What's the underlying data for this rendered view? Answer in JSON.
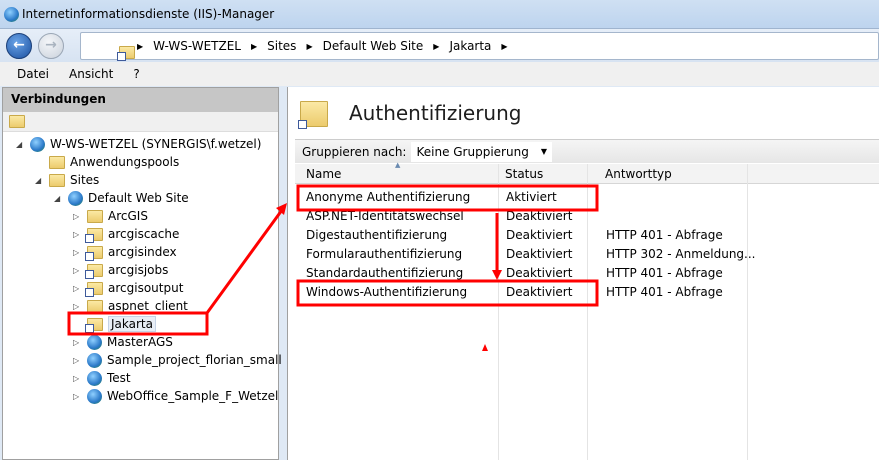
{
  "window": {
    "title": "Internetinformationsdienste (IIS)-Manager"
  },
  "address": {
    "crumbs": [
      "W-WS-WETZEL",
      "Sites",
      "Default Web Site",
      "Jakarta"
    ]
  },
  "menu": [
    "Datei",
    "Ansicht",
    "?"
  ],
  "connections": {
    "title": "Verbindungen",
    "tree": [
      {
        "label": "W-WS-WETZEL (SYNERGIS\\f.wetzel)",
        "icon": "server-icon",
        "level": 0,
        "toggle": "expanded"
      },
      {
        "label": "Anwendungspools",
        "icon": "app-pool-icon",
        "level": 1,
        "toggle": "none"
      },
      {
        "label": "Sites",
        "icon": "sites-folder-icon",
        "level": 1,
        "toggle": "expanded"
      },
      {
        "label": "Default Web Site",
        "icon": "globe-icon",
        "level": 2,
        "toggle": "expanded"
      },
      {
        "label": "ArcGIS",
        "icon": "folder-icon",
        "level": 3,
        "toggle": "collapsed"
      },
      {
        "label": "arcgiscache",
        "icon": "virtual-dir-icon",
        "level": 3,
        "toggle": "collapsed"
      },
      {
        "label": "arcgisindex",
        "icon": "virtual-dir-icon",
        "level": 3,
        "toggle": "collapsed"
      },
      {
        "label": "arcgisjobs",
        "icon": "virtual-dir-icon",
        "level": 3,
        "toggle": "collapsed"
      },
      {
        "label": "arcgisoutput",
        "icon": "virtual-dir-icon",
        "level": 3,
        "toggle": "collapsed"
      },
      {
        "label": "aspnet_client",
        "icon": "folder-icon",
        "level": 3,
        "toggle": "collapsed"
      },
      {
        "label": "Jakarta",
        "icon": "virtual-dir-icon",
        "level": 3,
        "toggle": "none",
        "selected": true
      },
      {
        "label": "MasterAGS",
        "icon": "application-icon",
        "level": 3,
        "toggle": "collapsed"
      },
      {
        "label": "Sample_project_florian_small",
        "icon": "application-icon",
        "level": 3,
        "toggle": "collapsed"
      },
      {
        "label": "Test",
        "icon": "application-icon",
        "level": 3,
        "toggle": "collapsed"
      },
      {
        "label": "WebOffice_Sample_F_Wetzel",
        "icon": "application-icon",
        "level": 3,
        "toggle": "collapsed"
      }
    ]
  },
  "main": {
    "title": "Authentifizierung",
    "group_label": "Gruppieren nach:",
    "group_value": "Keine Gruppierung",
    "columns": [
      "Name",
      "Status",
      "Antworttyp"
    ],
    "rows": [
      {
        "name": "Anonyme Authentifizierung",
        "status": "Aktiviert",
        "response": ""
      },
      {
        "name": "ASP.NET-Identitätswechsel",
        "status": "Deaktiviert",
        "response": ""
      },
      {
        "name": "Digestauthentifizierung",
        "status": "Deaktiviert",
        "response": "HTTP 401 - Abfrage"
      },
      {
        "name": "Formularauthentifizierung",
        "status": "Deaktiviert",
        "response": "HTTP 302 - Anmeldung..."
      },
      {
        "name": "Standardauthentifizierung",
        "status": "Deaktiviert",
        "response": "HTTP 401 - Abfrage"
      },
      {
        "name": "Windows-Authentifizierung",
        "status": "Deaktiviert",
        "response": "HTTP 401 - Abfrage"
      }
    ]
  },
  "annotation_color": "#ff0000"
}
